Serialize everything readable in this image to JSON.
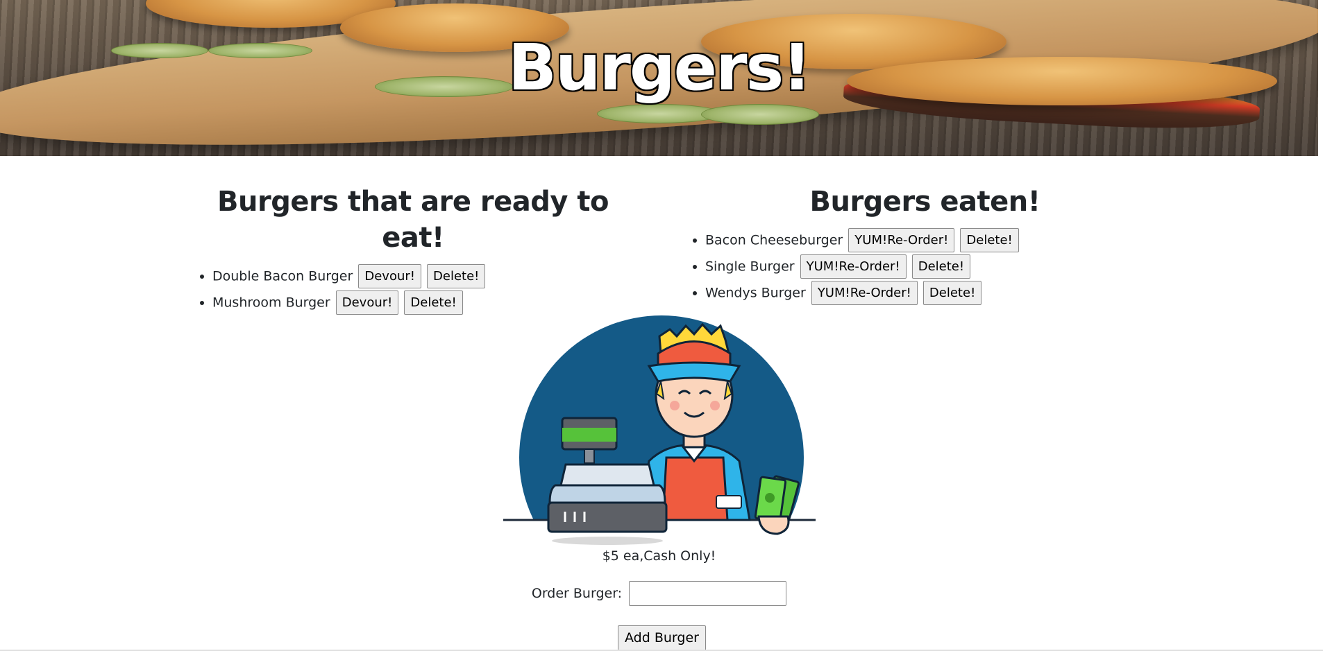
{
  "header": {
    "title": "Burgers!"
  },
  "ready": {
    "heading": "Burgers that are ready to eat!",
    "devour_label": "Devour!",
    "delete_label": "Delete!",
    "items": [
      {
        "name": "Double Bacon Burger"
      },
      {
        "name": "Mushroom Burger"
      }
    ]
  },
  "eaten": {
    "heading": "Burgers eaten!",
    "reorder_label": "YUM!Re-Order!",
    "delete_label": "Delete!",
    "items": [
      {
        "name": "Bacon Cheeseburger"
      },
      {
        "name": "Single Burger"
      },
      {
        "name": "Wendys Burger"
      }
    ]
  },
  "illustration": {
    "caption": "$5 ea,Cash Only!"
  },
  "form": {
    "label": "Order Burger:",
    "value": "",
    "submit_label": "Add Burger"
  },
  "colors": {
    "circle": "#145a87",
    "hat": "#ef5b3f",
    "hat_brim": "#2fb4e9",
    "apron": "#ef5b3f",
    "cash": "#56c23a"
  }
}
